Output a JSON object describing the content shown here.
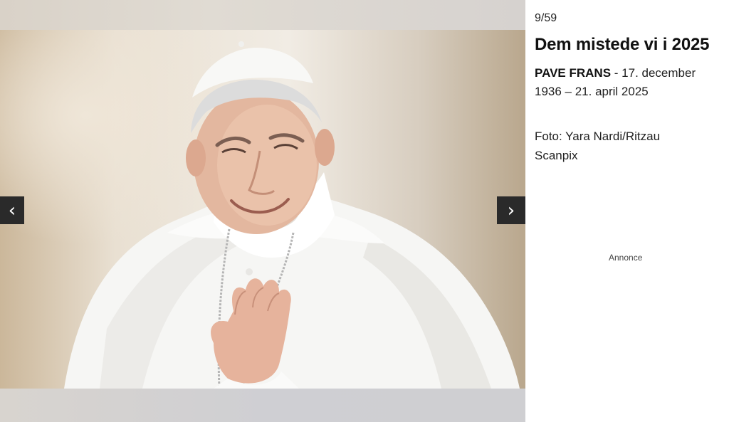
{
  "gallery": {
    "counter": "9/59",
    "title": "Dem mistede vi i 2025",
    "caption": {
      "name": "PAVE FRANS",
      "separator": " - ",
      "text": "17. december 1936 – 21. april 2025"
    },
    "credit": "Foto: Yara Nardi/Ritzau Scanpix",
    "prev_icon": "‹",
    "next_icon": "›"
  },
  "ad": {
    "label": "Annonce"
  },
  "icons": {
    "prev": "chevron-left-icon",
    "next": "chevron-right-icon"
  }
}
